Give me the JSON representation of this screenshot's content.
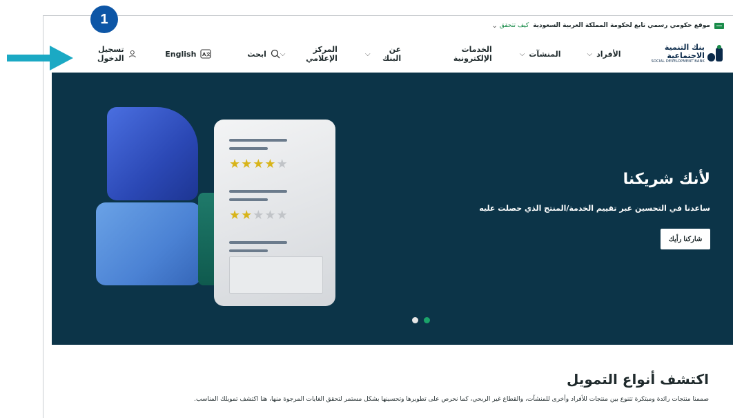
{
  "annotation": {
    "step_number": "1"
  },
  "gov_bar": {
    "text": "موقع حكومي رسمي تابع لحكومة المملكة العربية السعودية",
    "verify_link": "كيف تتحقق"
  },
  "logo": {
    "arabic": "بنك التنمية الاجتماعية",
    "english": "SOCIAL DEVELOPMENT BANK"
  },
  "nav": {
    "items": [
      {
        "label": "الأفراد",
        "has_dropdown": true
      },
      {
        "label": "المنشآت",
        "has_dropdown": true
      },
      {
        "label": "الخدمات الإلكترونية",
        "has_dropdown": false
      },
      {
        "label": "عن البنك",
        "has_dropdown": true
      },
      {
        "label": "المركز الإعلامي",
        "has_dropdown": true
      }
    ],
    "search_label": "ابحث",
    "language_label": "English",
    "login_label": "تسجيل الدخول"
  },
  "hero": {
    "title": "لأنك شريكنا",
    "subtitle": "ساعدنا في التحسين عبر تقييم الخدمة/المنتج الذي حصلت عليه",
    "button_label": "شاركنا رأيك",
    "slides_total": 2,
    "active_slide": 2,
    "ratings": [
      4,
      2
    ],
    "rating_max": 5
  },
  "financing": {
    "title": "اكتشف أنواع التمويل",
    "description": "صممنا منتجات رائدة ومبتكرة تتنوع بين منتجات للأفراد وأخرى للمنشآت، والقطاع غير الربحي، كما نحرص على تطويرها وتحسينها بشكل مستمر لتحقق الغايات المرجوة منها، هنا اكتشف تمويلك المناسب."
  },
  "colors": {
    "hero_bg": "#0c3448",
    "accent_green": "#1a8c4a",
    "annotation_blue": "#0d56a6",
    "arrow_teal": "#1ba9c4"
  }
}
